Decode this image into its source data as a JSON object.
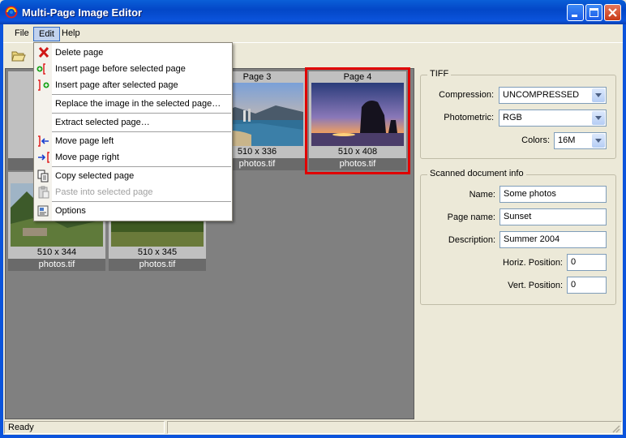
{
  "window": {
    "title": "Multi-Page Image Editor"
  },
  "menu": {
    "file": "File",
    "edit": "Edit",
    "help": "Help"
  },
  "edit_menu": [
    {
      "label": "Delete page",
      "icon": "delete-x-icon",
      "enabled": true
    },
    {
      "label": "Insert page before selected page",
      "icon": "insert-before-icon",
      "enabled": true
    },
    {
      "label": "Insert page after selected page",
      "icon": "insert-after-icon",
      "enabled": true
    },
    {
      "label": "Replace the image in the selected page…",
      "icon": "",
      "enabled": true
    },
    {
      "label": "Extract selected page…",
      "icon": "",
      "enabled": true
    },
    {
      "label": "Move page left",
      "icon": "move-left-icon",
      "enabled": true
    },
    {
      "label": "Move page right",
      "icon": "move-right-icon",
      "enabled": true
    },
    {
      "label": "Copy selected page",
      "icon": "copy-icon",
      "enabled": true
    },
    {
      "label": "Paste into selected page",
      "icon": "paste-icon",
      "enabled": false
    },
    {
      "label": "Options",
      "icon": "options-icon",
      "enabled": true
    }
  ],
  "pages": [
    {
      "title": "Page 3",
      "dims": "510 x 336",
      "file": "photos.tif"
    },
    {
      "title": "Page 4",
      "dims": "510 x 408",
      "file": "photos.tif",
      "selected": true
    },
    {
      "title": "",
      "dims": "510 x 344",
      "file": "photos.tif"
    },
    {
      "title": "",
      "dims": "510 x 345",
      "file": "photos.tif"
    }
  ],
  "tiff": {
    "legend": "TIFF",
    "compression_label": "Compression:",
    "compression": "UNCOMPRESSED",
    "photometric_label": "Photometric:",
    "photometric": "RGB",
    "colors_label": "Colors:",
    "colors": "16M"
  },
  "scanned": {
    "legend": "Scanned document info",
    "name_label": "Name:",
    "name": "Some photos",
    "page_name_label": "Page name:",
    "page_name": "Sunset",
    "description_label": "Description:",
    "description": "Summer 2004",
    "horiz_label": "Horiz. Position:",
    "horiz": "0",
    "vert_label": "Vert. Position:",
    "vert": "0"
  },
  "status": {
    "text": "Ready"
  },
  "colors": {
    "selection_border": "#e00000",
    "title_bar": "#0a5fd8"
  }
}
